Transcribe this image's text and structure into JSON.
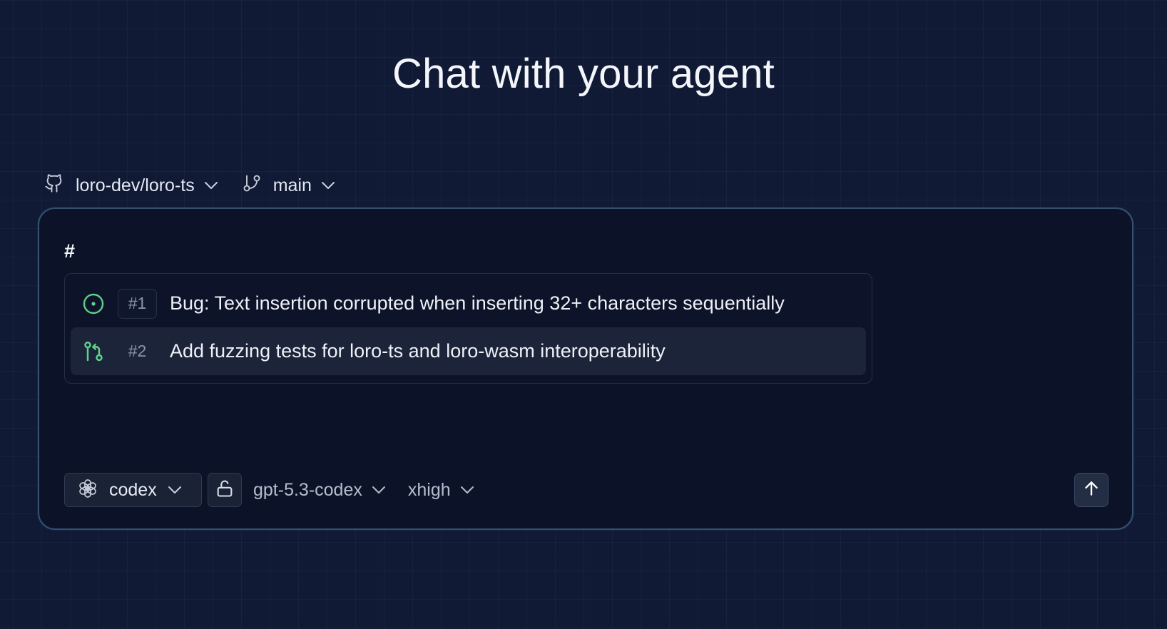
{
  "page": {
    "title": "Chat with your agent"
  },
  "repo_bar": {
    "repo_icon": "github-icon",
    "repo": "loro-dev/loro-ts",
    "branch_icon": "git-branch-icon",
    "branch": "main"
  },
  "composer": {
    "input_text": "#",
    "suggestions": [
      {
        "icon": "issue-open-icon",
        "number": "#1",
        "title": "Bug: Text insertion corrupted when inserting 32+ characters sequentially",
        "icon_color": "#5fd08a"
      },
      {
        "icon": "pull-request-icon",
        "number": "#2",
        "title": "Add fuzzing tests for loro-ts and loro-wasm interoperability",
        "icon_color": "#5fd08a"
      }
    ],
    "toolbar": {
      "agent_icon": "openai-icon",
      "agent": "codex",
      "lock_icon": "unlock-icon",
      "model": "gpt-5.3-codex",
      "effort": "xhigh",
      "send_icon": "arrow-up-icon"
    }
  },
  "colors": {
    "background": "#101a35",
    "composer_border": "#34506f",
    "accent_green": "#5fd08a"
  }
}
